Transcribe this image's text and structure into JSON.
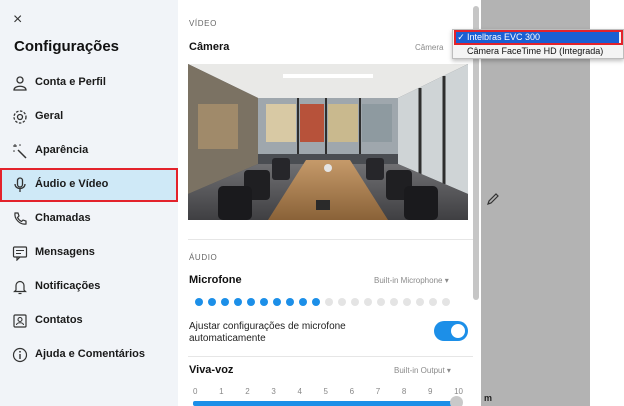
{
  "sidebar": {
    "close_glyph": "×",
    "title": "Configurações",
    "items": [
      {
        "label": "Conta e Perfil",
        "icon": "person-icon"
      },
      {
        "label": "Geral",
        "icon": "gear-icon"
      },
      {
        "label": "Aparência",
        "icon": "magic-wand-icon"
      },
      {
        "label": "Áudio e Vídeo",
        "icon": "microphone-icon",
        "active": true
      },
      {
        "label": "Chamadas",
        "icon": "phone-icon"
      },
      {
        "label": "Mensagens",
        "icon": "message-icon"
      },
      {
        "label": "Notificações",
        "icon": "bell-icon"
      },
      {
        "label": "Contatos",
        "icon": "contact-card-icon"
      },
      {
        "label": "Ajuda e Comentários",
        "icon": "info-icon"
      }
    ]
  },
  "video": {
    "section_label": "VÍDEO",
    "camera_label": "Câmera",
    "camera_value": "Câmera"
  },
  "audio": {
    "section_label": "ÁUDIO",
    "mic_label": "Microfone",
    "mic_value": "Built-in Microphone",
    "mic_level": 0.5,
    "mic_dot_count": 20,
    "auto_adjust_label": "Ajustar configurações de microfone automaticamente",
    "auto_adjust_enabled": true,
    "speaker_label": "Viva-voz",
    "speaker_value": "Built-in Output",
    "scale": [
      "0",
      "1",
      "2",
      "3",
      "4",
      "5",
      "6",
      "7",
      "8",
      "9",
      "10"
    ],
    "speaker_volume": 10
  },
  "dropdown": {
    "check": "✓",
    "selected": "Intelbras EVC 300",
    "other": "Câmera FaceTime HD (Integrada)"
  },
  "overlay_glyph": "m",
  "colors": {
    "accent": "#1c8fe8",
    "active_nav": "#cfe9f7",
    "highlight": "#e3222b",
    "dot_inactive": "#e4e4e4"
  }
}
